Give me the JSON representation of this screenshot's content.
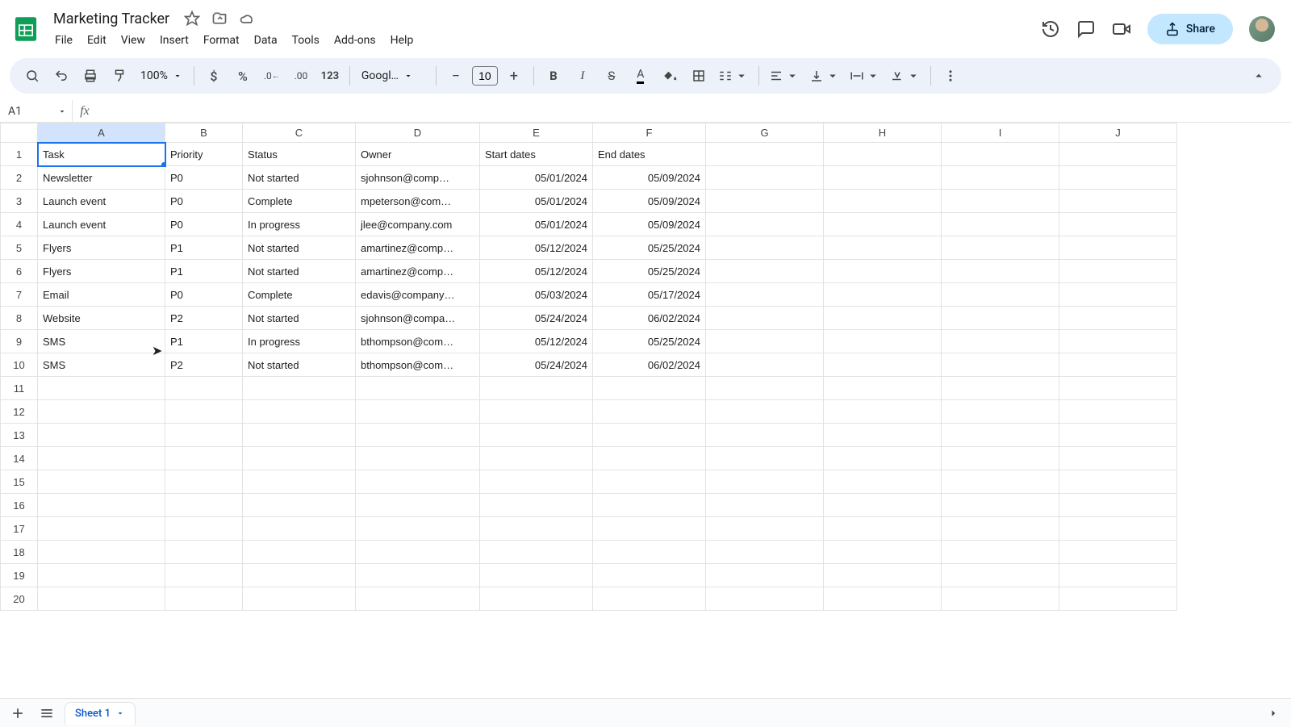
{
  "doc": {
    "title": "Marketing Tracker"
  },
  "menu": [
    "File",
    "Edit",
    "View",
    "Insert",
    "Format",
    "Data",
    "Tools",
    "Add-ons",
    "Help"
  ],
  "share_label": "Share",
  "toolbar": {
    "zoom": "100%",
    "font": "Googl…",
    "fontSize": "10"
  },
  "nameBox": "A1",
  "columns": [
    "A",
    "B",
    "C",
    "D",
    "E",
    "F",
    "G",
    "H",
    "I",
    "J"
  ],
  "colWidths": [
    "col-A",
    "col-B",
    "col-C",
    "col-D",
    "col-E",
    "col-F",
    "col-G",
    "col-H",
    "col-I",
    "col-J"
  ],
  "headers": [
    "Task",
    "Priority",
    "Status",
    "Owner",
    "Start dates",
    "End dates"
  ],
  "rows": [
    [
      "Newsletter",
      "P0",
      "Not started",
      "sjohnson@comp…",
      "05/01/2024",
      "05/09/2024"
    ],
    [
      "Launch event",
      "P0",
      "Complete",
      "mpeterson@com…",
      "05/01/2024",
      "05/09/2024"
    ],
    [
      "Launch event",
      "P0",
      "In progress",
      "jlee@company.com",
      "05/01/2024",
      "05/09/2024"
    ],
    [
      "Flyers",
      "P1",
      "Not started",
      "amartinez@comp…",
      "05/12/2024",
      "05/25/2024"
    ],
    [
      "Flyers",
      "P1",
      "Not started",
      "amartinez@comp…",
      "05/12/2024",
      "05/25/2024"
    ],
    [
      "Email",
      "P0",
      "Complete",
      "edavis@company…",
      "05/03/2024",
      "05/17/2024"
    ],
    [
      "Website",
      "P2",
      "Not started",
      "sjohnson@compa…",
      "05/24/2024",
      "06/02/2024"
    ],
    [
      "SMS",
      "P1",
      "In progress",
      "bthompson@com…",
      "05/12/2024",
      "05/25/2024"
    ],
    [
      "SMS",
      "P2",
      "Not started",
      "bthompson@com…",
      "05/24/2024",
      "06/02/2024"
    ]
  ],
  "totalRows": 20,
  "sheetTab": "Sheet 1"
}
